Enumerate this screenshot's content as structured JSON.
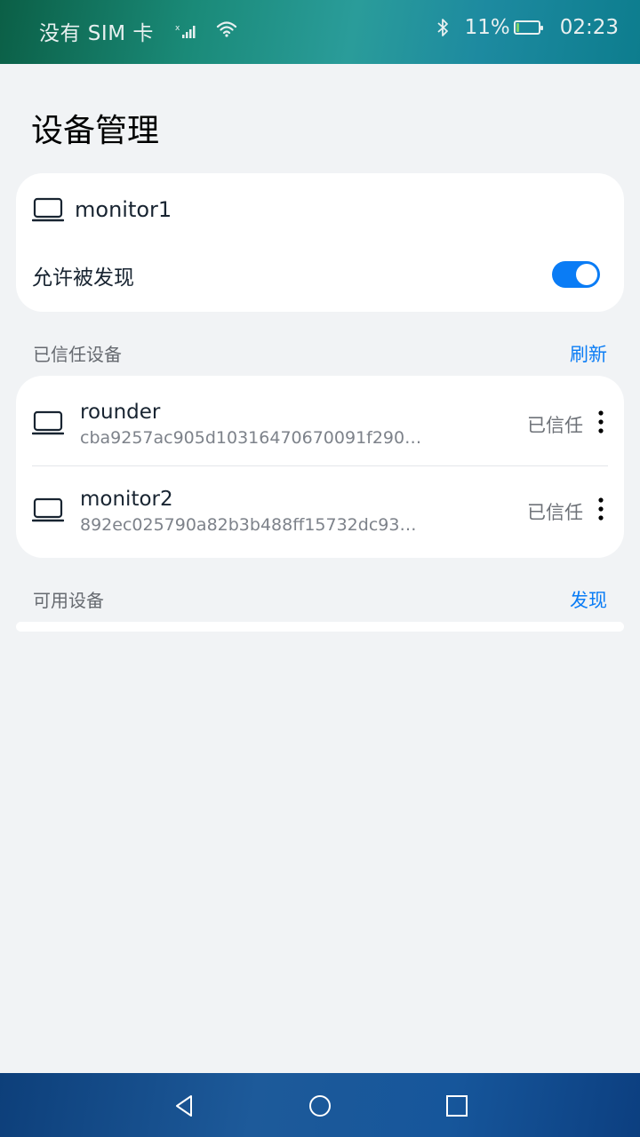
{
  "status_bar": {
    "carrier": "没有 SIM 卡",
    "battery": "11%",
    "battery_level": 0.11,
    "time": "02:23",
    "icons": [
      "signal-icon",
      "wifi-icon",
      "bluetooth-icon",
      "battery-icon"
    ]
  },
  "page": {
    "title": "设备管理"
  },
  "local_device": {
    "name": "monitor1",
    "icon": "laptop-icon",
    "discoverable_label": "允许被发现",
    "discoverable": true
  },
  "trusted_section": {
    "label": "已信任设备",
    "action": "刷新",
    "devices": [
      {
        "name": "rounder",
        "id": "cba9257ac905d10316470670091f290…",
        "status": "已信任",
        "icon": "laptop-icon"
      },
      {
        "name": "monitor2",
        "id": "892ec025790a82b3b488ff15732dc93…",
        "status": "已信任",
        "icon": "laptop-icon"
      }
    ]
  },
  "available_section": {
    "label": "可用设备",
    "action": "发现",
    "devices": []
  },
  "nav_bar": {
    "buttons": [
      "back-icon",
      "home-icon",
      "recents-icon"
    ]
  },
  "colors": {
    "accent": "#0a7cf5",
    "background": "#f1f3f5",
    "card": "#ffffff"
  }
}
